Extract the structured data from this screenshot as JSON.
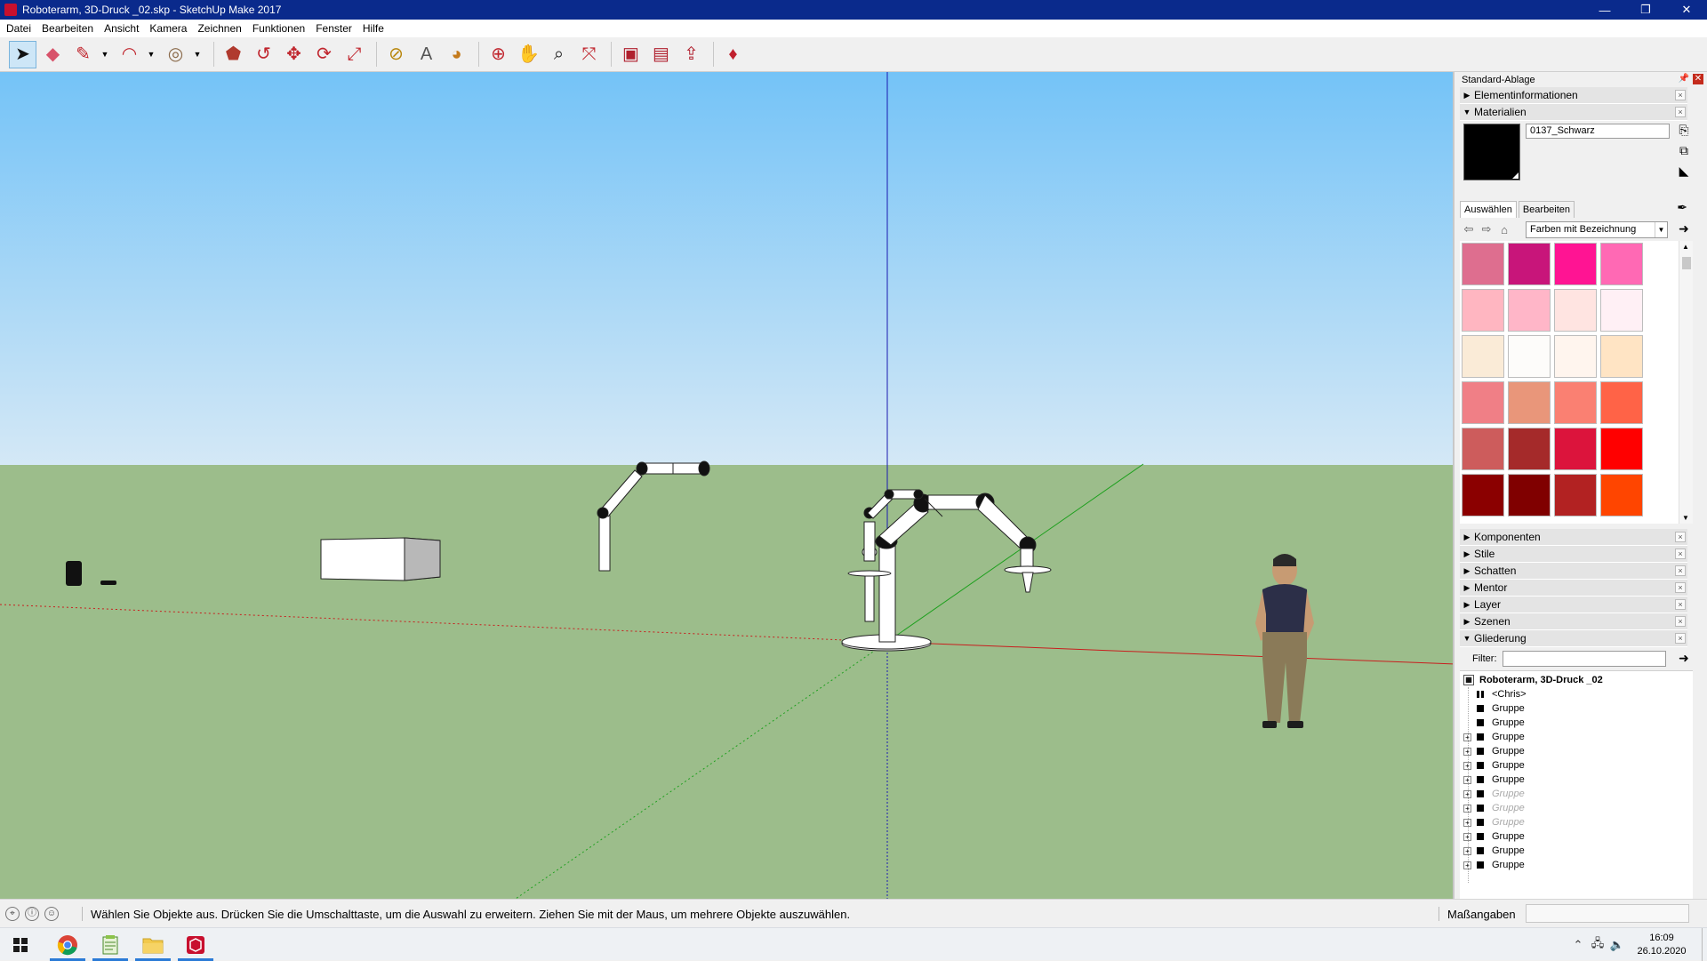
{
  "window": {
    "title": "Roboterarm, 3D-Druck _02.skp - SketchUp Make 2017",
    "minimize_label": "—",
    "maximize_label": "❐",
    "close_label": "✕"
  },
  "menu": [
    "Datei",
    "Bearbeiten",
    "Ansicht",
    "Kamera",
    "Zeichnen",
    "Funktionen",
    "Fenster",
    "Hilfe"
  ],
  "toolbar": {
    "tools": [
      {
        "name": "select-tool",
        "icon": "arrow-cursor-icon",
        "glyph": "➤",
        "color": "#111111",
        "active": true
      },
      {
        "name": "eraser-tool",
        "icon": "eraser-icon",
        "glyph": "◆",
        "color": "#d8526a"
      },
      {
        "name": "line-tool",
        "icon": "pencil-icon",
        "glyph": "✎",
        "color": "#c0262e",
        "dropdown": true
      },
      {
        "name": "arc-tool",
        "icon": "arc-icon",
        "glyph": "◠",
        "color": "#c0262e",
        "dropdown": true
      },
      {
        "name": "shape-tool",
        "icon": "circle-icon",
        "glyph": "◎",
        "color": "#8a6a4a",
        "dropdown": true
      },
      {
        "name": "push-pull-tool",
        "icon": "push-pull-icon",
        "glyph": "⬟",
        "color": "#b03a2e"
      },
      {
        "name": "offset-tool",
        "icon": "follow-me-icon",
        "glyph": "↺",
        "color": "#c0262e"
      },
      {
        "name": "move-tool",
        "icon": "move-icon",
        "glyph": "✥",
        "color": "#c0262e"
      },
      {
        "name": "rotate-tool",
        "icon": "rotate-icon",
        "glyph": "⟳",
        "color": "#c0262e"
      },
      {
        "name": "scale-tool",
        "icon": "scale-icon",
        "glyph": "⤢",
        "color": "#c0262e"
      },
      {
        "name": "tape-measure-tool",
        "icon": "tape-measure-icon",
        "glyph": "⊘",
        "color": "#b8860b"
      },
      {
        "name": "text-tool",
        "icon": "text-icon",
        "glyph": "A",
        "color": "#555555"
      },
      {
        "name": "paint-bucket-tool",
        "icon": "paint-bucket-icon",
        "glyph": "◕",
        "color": "#c47a1b"
      },
      {
        "name": "orbit-tool",
        "icon": "orbit-icon",
        "glyph": "⊕",
        "color": "#c0262e"
      },
      {
        "name": "pan-tool",
        "icon": "hand-icon",
        "glyph": "✋",
        "color": "#d8a040"
      },
      {
        "name": "zoom-tool",
        "icon": "magnifier-icon",
        "glyph": "⌕",
        "color": "#222222"
      },
      {
        "name": "zoom-extents-tool",
        "icon": "zoom-extents-icon",
        "glyph": "⤧",
        "color": "#c0262e"
      },
      {
        "name": "warehouse-tool",
        "icon": "3d-warehouse-icon",
        "glyph": "▣",
        "color": "#b0202e"
      },
      {
        "name": "extension-warehouse-tool",
        "icon": "extension-warehouse-icon",
        "glyph": "▤",
        "color": "#b0202e"
      },
      {
        "name": "share-model-tool",
        "icon": "share-model-icon",
        "glyph": "⇪",
        "color": "#b0202e"
      },
      {
        "name": "extension-manager-tool",
        "icon": "ruby-gem-icon",
        "glyph": "♦",
        "color": "#c0202e"
      }
    ]
  },
  "colors": {
    "sky_top": "#74c3f7",
    "sky_bottom": "#d4e8f6",
    "ground": "#9cbd8b",
    "red_axis": "#c81e1e",
    "green_axis": "#1ea01e",
    "blue_axis": "#1a1ab0"
  },
  "tray": {
    "title": "Standard-Ablage",
    "panels_top": [
      {
        "label": "Elementinformationen",
        "expanded": false
      },
      {
        "label": "Materialien",
        "expanded": true
      }
    ],
    "materials": {
      "current_name": "0137_Schwarz",
      "current_color": "#000000",
      "tabs": [
        "Auswählen",
        "Bearbeiten"
      ],
      "collection": "Farben mit Bezeichnung",
      "swatches": [
        "#de6e8f",
        "#c8157a",
        "#ff1493",
        "#ff69b4",
        "#ffb6c1",
        "#ffb6c8",
        "#ffe4e1",
        "#fff0f5",
        "#faebd7",
        "#fdfcfa",
        "#fff5ee",
        "#ffe4c4",
        "#f07f86",
        "#e9967a",
        "#fa8072",
        "#ff6347",
        "#cd5c5c",
        "#a52a2a",
        "#dc143c",
        "#ff0000",
        "#8b0000",
        "#800000",
        "#b22222",
        "#ff4500"
      ]
    },
    "panels_bottom": [
      {
        "label": "Komponenten",
        "expanded": false
      },
      {
        "label": "Stile",
        "expanded": false
      },
      {
        "label": "Schatten",
        "expanded": false
      },
      {
        "label": "Mentor",
        "expanded": false
      },
      {
        "label": "Layer",
        "expanded": false
      },
      {
        "label": "Szenen",
        "expanded": false
      },
      {
        "label": "Gliederung",
        "expanded": true
      }
    ],
    "outliner": {
      "filter_label": "Filter:",
      "filter_value": "",
      "root": "Roboterarm, 3D-Druck _02",
      "items": [
        {
          "label": "<Chris>",
          "expandable": false,
          "hidden": false,
          "component": true
        },
        {
          "label": "Gruppe",
          "expandable": false,
          "hidden": false
        },
        {
          "label": "Gruppe",
          "expandable": false,
          "hidden": false
        },
        {
          "label": "Gruppe",
          "expandable": true,
          "hidden": false
        },
        {
          "label": "Gruppe",
          "expandable": true,
          "hidden": false
        },
        {
          "label": "Gruppe",
          "expandable": true,
          "hidden": false
        },
        {
          "label": "Gruppe",
          "expandable": true,
          "hidden": false
        },
        {
          "label": "Gruppe",
          "expandable": true,
          "hidden": true
        },
        {
          "label": "Gruppe",
          "expandable": true,
          "hidden": true
        },
        {
          "label": "Gruppe",
          "expandable": true,
          "hidden": true
        },
        {
          "label": "Gruppe",
          "expandable": true,
          "hidden": false
        },
        {
          "label": "Gruppe",
          "expandable": true,
          "hidden": false
        },
        {
          "label": "Gruppe",
          "expandable": true,
          "hidden": false
        }
      ]
    }
  },
  "statusbar": {
    "message": "Wählen Sie Objekte aus. Drücken Sie die Umschalttaste, um die Auswahl zu erweitern. Ziehen Sie mit der Maus, um mehrere Objekte auszuwählen.",
    "measurements_label": "Maßangaben",
    "measurements_value": ""
  },
  "taskbar": {
    "apps": [
      {
        "name": "chrome",
        "icon": "chrome-icon"
      },
      {
        "name": "notepad-plus",
        "icon": "notepad-icon"
      },
      {
        "name": "file-explorer",
        "icon": "folder-icon"
      },
      {
        "name": "sketchup",
        "icon": "sketchup-icon"
      }
    ],
    "time": "16:09",
    "date": "26.10.2020"
  }
}
